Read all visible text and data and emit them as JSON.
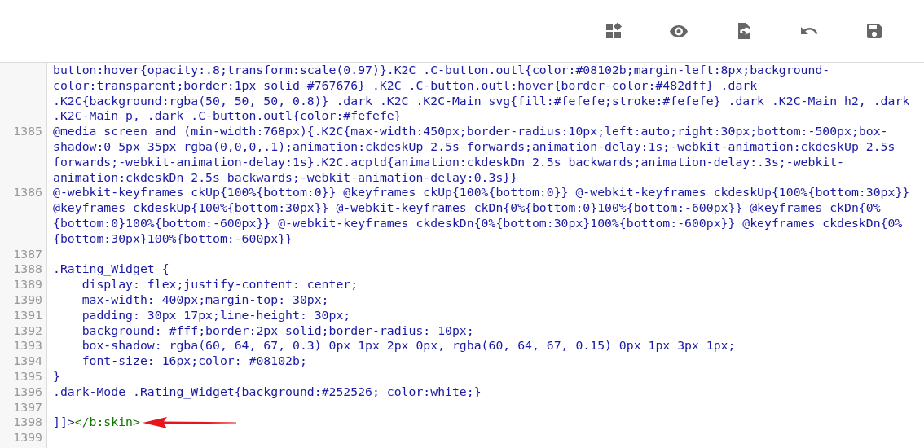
{
  "toolbar": {
    "buttons": [
      {
        "kind": "widgets"
      },
      {
        "kind": "preview"
      },
      {
        "kind": "revert"
      },
      {
        "kind": "undo"
      },
      {
        "kind": "save"
      }
    ]
  },
  "editor": {
    "lines": [
      {
        "rows": [
          "button:hover{opacity:.8;transform:scale(0.97)}.K2C .C-button.outl{color:#08102b;margin-left:8px;background-",
          "color:transparent;border:1px solid #767676} .K2C .C-button.outl:hover{border-color:#482dff} .dark",
          ".K2C{background:rgba(50, 50, 50, 0.8)} .dark .K2C .K2C-Main svg{fill:#fefefe;stroke:#fefefe} .dark .K2C-Main h2, .dark",
          ".K2C-Main p, .dark .C-button.outl{color:#fefefe}"
        ]
      },
      {
        "number": "1385",
        "rows": [
          "@media screen and (min-width:768px){.K2C{max-width:450px;border-radius:10px;left:auto;right:30px;bottom:-500px;box-",
          "shadow:0 5px 35px rgba(0,0,0,.1);animation:ckdeskUp 2.5s forwards;animation-delay:1s;-webkit-animation:ckdeskUp 2.5s",
          "forwards;-webkit-animation-delay:1s}.K2C.acptd{animation:ckdeskDn 2.5s backwards;animation-delay:.3s;-webkit-",
          "animation:ckdeskDn 2.5s backwards;-webkit-animation-delay:0.3s}}"
        ]
      },
      {
        "number": "1386",
        "rows": [
          "@-webkit-keyframes ckUp{100%{bottom:0}} @keyframes ckUp{100%{bottom:0}} @-webkit-keyframes ckdeskUp{100%{bottom:30px}}",
          "@keyframes ckdeskUp{100%{bottom:30px}} @-webkit-keyframes ckDn{0%{bottom:0}100%{bottom:-600px}} @keyframes ckDn{0%",
          "{bottom:0}100%{bottom:-600px}} @-webkit-keyframes ckdeskDn{0%{bottom:30px}100%{bottom:-600px}} @keyframes ckdeskDn{0%",
          "{bottom:30px}100%{bottom:-600px}}"
        ]
      },
      {
        "number": "1387"
      },
      {
        "number": "1388",
        "rows": [
          ".Rating_Widget {"
        ]
      },
      {
        "number": "1389",
        "rows": [
          "    display: flex;justify-content: center;"
        ]
      },
      {
        "number": "1390",
        "rows": [
          "    max-width: 400px;margin-top: 30px;"
        ]
      },
      {
        "number": "1391",
        "rows": [
          "    padding: 30px 17px;line-height: 30px;"
        ]
      },
      {
        "number": "1392",
        "rows": [
          "    background: #fff;border:2px solid;border-radius: 10px;"
        ]
      },
      {
        "number": "1393",
        "rows": [
          "    box-shadow: rgba(60, 64, 67, 0.3) 0px 1px 2px 0px, rgba(60, 64, 67, 0.15) 0px 1px 3px 1px;"
        ]
      },
      {
        "number": "1394",
        "rows": [
          "    font-size: 16px;color: #08102b;"
        ]
      },
      {
        "number": "1395",
        "rows": [
          "}"
        ]
      },
      {
        "number": "1396",
        "rows": [
          ".dark-Mode .Rating_Widget{background:#252526; color:white;}"
        ]
      },
      {
        "number": "1397"
      },
      {
        "number": "1398",
        "tokens": [
          {
            "kind": "cdata",
            "text": "]]>"
          },
          {
            "kind": "tag",
            "text": "</b:skin>"
          },
          {
            "kind": "arrow"
          }
        ]
      },
      {
        "number": "1399"
      }
    ]
  }
}
